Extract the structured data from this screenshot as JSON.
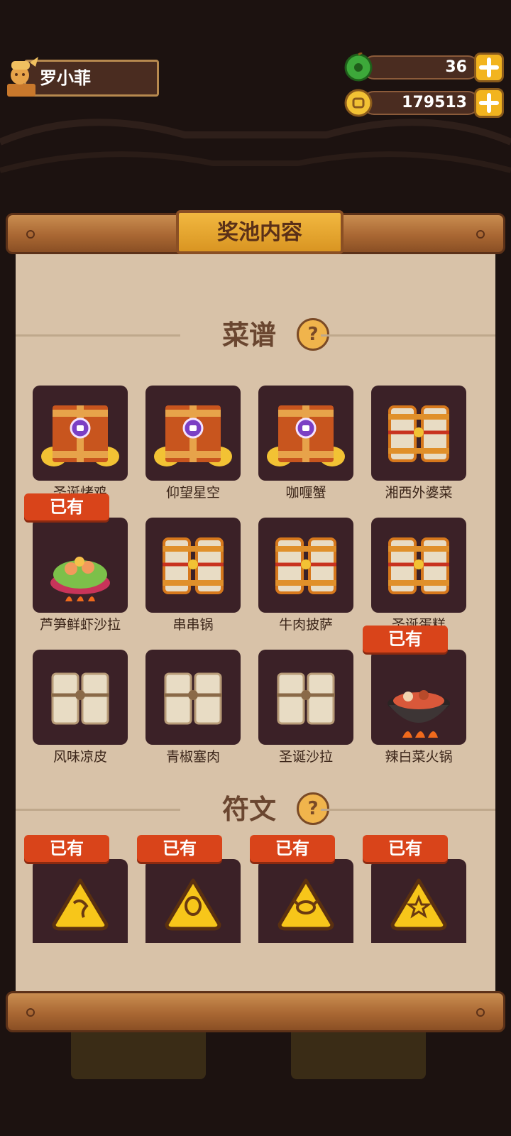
{
  "player": {
    "name": "罗小菲"
  },
  "currencies": [
    {
      "icon": "jade-coin-icon",
      "amount": "36"
    },
    {
      "icon": "gold-coin-icon",
      "amount": "179513"
    }
  ],
  "panel": {
    "title": "奖池内容"
  },
  "owned_badge": "已有",
  "sections": {
    "recipes": {
      "title": "菜谱",
      "help": "?"
    },
    "runes": {
      "title": "符文",
      "help": "?"
    }
  },
  "recipes": [
    {
      "name": "圣诞烤鸡",
      "art": "divine-recipe-scroll-icon",
      "owned": false
    },
    {
      "name": "仰望星空",
      "art": "divine-recipe-scroll-icon",
      "owned": false
    },
    {
      "name": "咖喱蟹",
      "art": "divine-recipe-scroll-icon",
      "owned": false
    },
    {
      "name": "湘西外婆菜",
      "art": "gold-recipe-scroll-icon",
      "owned": false
    },
    {
      "name": "芦笋鲜虾沙拉",
      "art": "asparagus-shrimp-salad-dish-icon",
      "owned": true
    },
    {
      "name": "串串锅",
      "art": "gold-recipe-scroll-icon",
      "owned": false
    },
    {
      "name": "牛肉披萨",
      "art": "gold-recipe-scroll-icon",
      "owned": false
    },
    {
      "name": "圣诞蛋糕",
      "art": "gold-recipe-scroll-icon",
      "owned": false
    },
    {
      "name": "风味凉皮",
      "art": "plain-recipe-scroll-icon",
      "owned": false
    },
    {
      "name": "青椒塞肉",
      "art": "plain-recipe-scroll-icon",
      "owned": false
    },
    {
      "name": "圣诞沙拉",
      "art": "plain-recipe-scroll-icon",
      "owned": false
    },
    {
      "name": "辣白菜火锅",
      "art": "kimchi-hotpot-dish-icon",
      "owned": true
    }
  ],
  "runes": [
    {
      "art": "shrimp-rune-icon",
      "owned": true
    },
    {
      "art": "squid-rune-icon",
      "owned": true
    },
    {
      "art": "crab-rune-icon",
      "owned": true
    },
    {
      "art": "starfish-rune-icon",
      "owned": true
    }
  ]
}
